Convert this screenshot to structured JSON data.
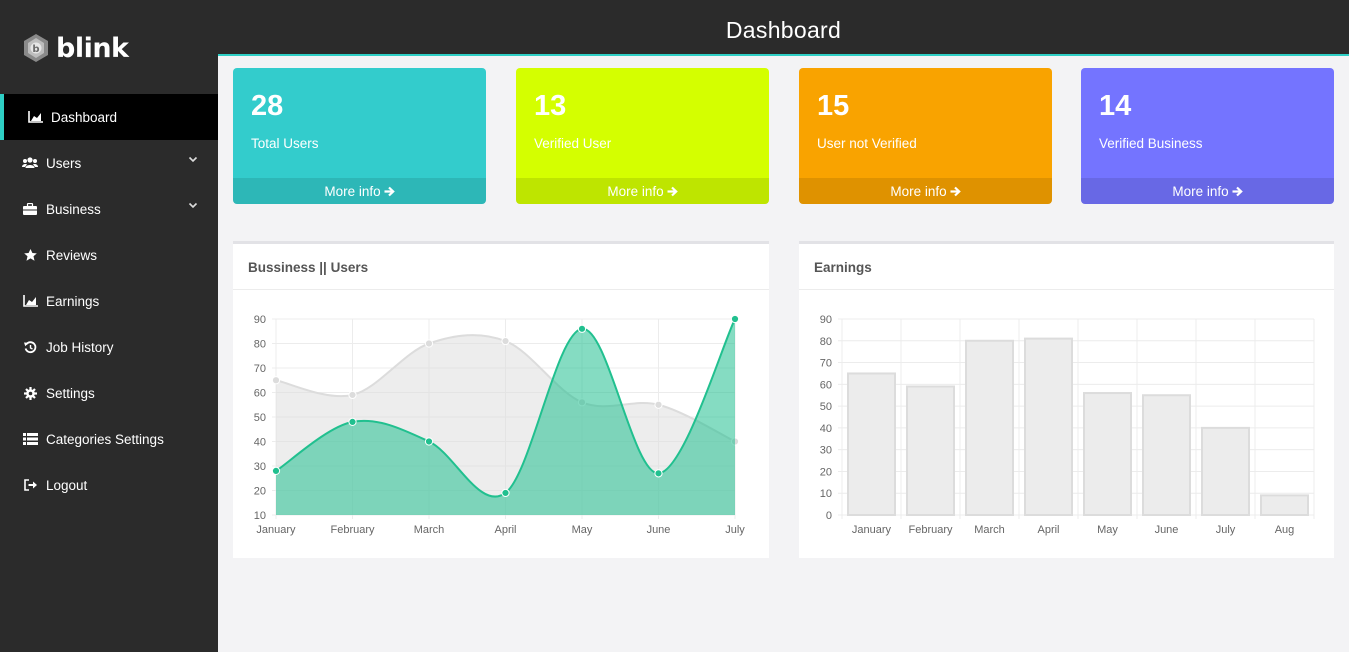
{
  "app": {
    "brand": "blink"
  },
  "header": {
    "title": "Dashboard"
  },
  "sidebar": {
    "items": [
      {
        "label": "Dashboard",
        "icon": "area-chart-icon",
        "active": true
      },
      {
        "label": "Users",
        "icon": "users-icon",
        "caret": true
      },
      {
        "label": "Business",
        "icon": "briefcase-icon",
        "caret": true
      },
      {
        "label": "Reviews",
        "icon": "star-icon"
      },
      {
        "label": "Earnings",
        "icon": "area-chart-icon"
      },
      {
        "label": "Job History",
        "icon": "history-icon"
      },
      {
        "label": "Settings",
        "icon": "gear-icon"
      },
      {
        "label": "Categories Settings",
        "icon": "list-icon"
      },
      {
        "label": "Logout",
        "icon": "logout-icon"
      }
    ]
  },
  "cards": [
    {
      "value": "28",
      "label": "Total Users",
      "footer": "More info",
      "color": "#33cccc"
    },
    {
      "value": "13",
      "label": "Verified User",
      "footer": "More info",
      "color": "#d4ff00"
    },
    {
      "value": "15",
      "label": "User not Verified",
      "footer": "More info",
      "color": "#f9a300"
    },
    {
      "value": "14",
      "label": "Verified Business",
      "footer": "More info",
      "color": "#7474ff"
    }
  ],
  "panels": {
    "left_title": "Bussiness || Users",
    "right_title": "Earnings"
  },
  "colors": {
    "accent": "#2ecfc5",
    "series_green": "#21c08f",
    "series_gray": "#dcdcdc"
  },
  "chart_data": [
    {
      "type": "area",
      "title": "Bussiness || Users",
      "categories": [
        "January",
        "February",
        "March",
        "April",
        "May",
        "June",
        "July"
      ],
      "ylim": [
        10,
        90
      ],
      "yticks": [
        10,
        20,
        30,
        40,
        50,
        60,
        70,
        80,
        90
      ],
      "grid": true,
      "series": [
        {
          "values": [
            65,
            59,
            80,
            81,
            56,
            55,
            40
          ]
        },
        {
          "values": [
            28,
            48,
            40,
            19,
            86,
            27,
            90
          ]
        }
      ]
    },
    {
      "type": "bar",
      "title": "Earnings",
      "categories": [
        "January",
        "February",
        "March",
        "April",
        "May",
        "June",
        "July",
        "Aug"
      ],
      "values": [
        65,
        59,
        80,
        81,
        56,
        55,
        40,
        9
      ],
      "ylim": [
        0,
        90
      ],
      "yticks": [
        0,
        10,
        20,
        30,
        40,
        50,
        60,
        70,
        80,
        90
      ],
      "grid": true
    }
  ]
}
